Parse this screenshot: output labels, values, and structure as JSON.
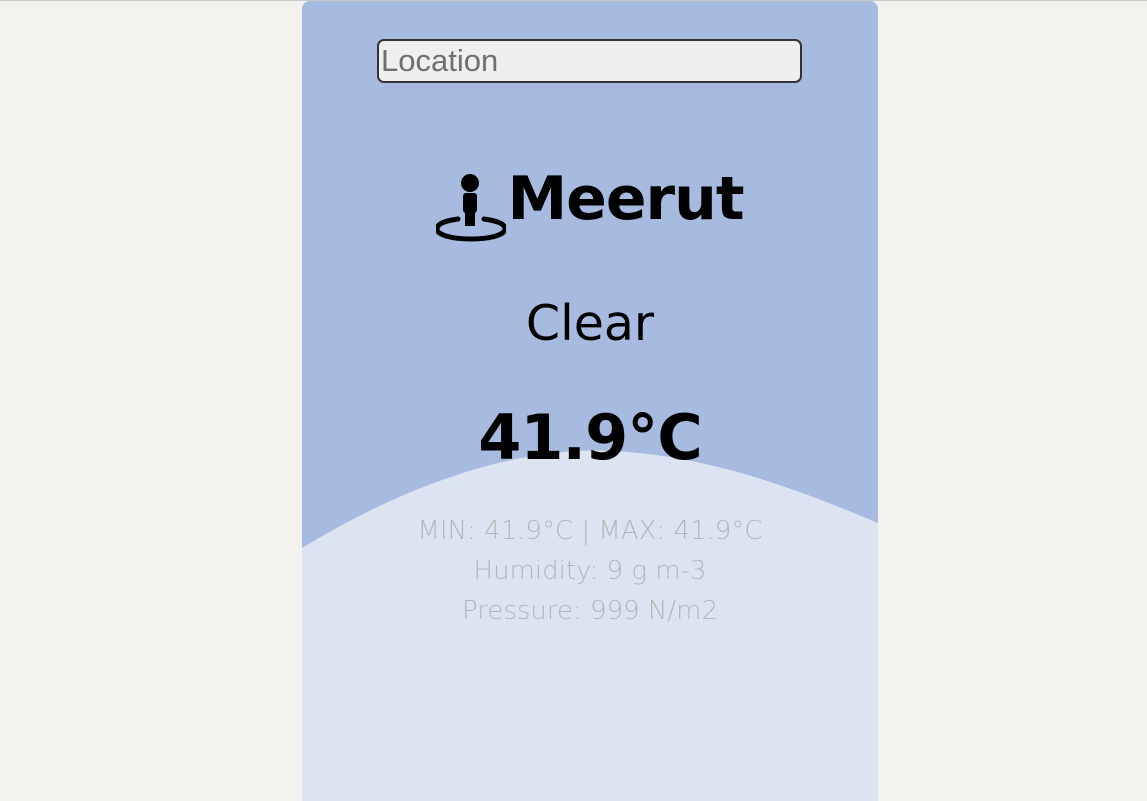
{
  "search": {
    "placeholder": "Location",
    "value": ""
  },
  "weather": {
    "city": "Meerut",
    "location_icon": "person-pin-icon",
    "condition": "Clear",
    "temperature": "41.9°C",
    "min_max": "MIN: 41.9°C | MAX: 41.9°C",
    "humidity": "Humidity: 9 g m-3",
    "pressure": "Pressure: 999 N/m2"
  },
  "colors": {
    "page_bg": "#f3f2ef",
    "card_top": "#a6bbdf",
    "card_bottom": "#e0e7f3",
    "detail_text": "#b5b5b5"
  }
}
